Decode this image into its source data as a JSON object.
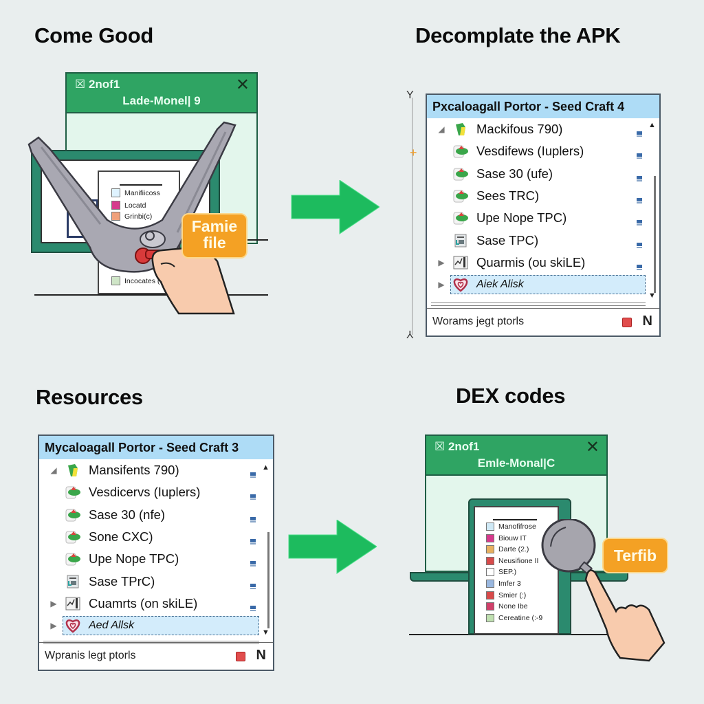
{
  "panels": {
    "top_left": {
      "heading": "Come Good",
      "window": {
        "line1": "☒ 2nof1",
        "line2": "Lade-Monel| 9",
        "close": "✕"
      },
      "paper_items": [
        "Manifiicoss",
        "Locatd",
        "Grinbi(c)",
        "Incocates (3"
      ],
      "callout": {
        "line1": "Famie",
        "line2": "file"
      },
      "tool_icon": "wrench-icon",
      "hand_icon": "hand-pointer-icon"
    },
    "top_right": {
      "heading": "Decomplate the APK",
      "tree": {
        "title": "Pxcaloagall Portor - Seed Craft 4",
        "rows": [
          {
            "toggle": "◢",
            "icon": "android-icon",
            "label": "Mackifous 790)"
          },
          {
            "toggle": "",
            "icon": "package-icon",
            "label": "Vesdifews (Iuplers)"
          },
          {
            "toggle": "",
            "icon": "package-icon",
            "label": "Sase 30 (ufe)"
          },
          {
            "toggle": "",
            "icon": "package-icon",
            "label": "Sees TRC)"
          },
          {
            "toggle": "",
            "icon": "package-icon",
            "label": "Upe Nope TPC)"
          },
          {
            "toggle": "",
            "icon": "file-icon",
            "label": "Sase TPC)"
          },
          {
            "toggle": "▶",
            "icon": "chart-icon",
            "label": "Quarmis (ou skiLE)"
          },
          {
            "toggle": "▶",
            "icon": "heart-icon",
            "label": "Aiek Alisk",
            "selected": true
          }
        ],
        "footer": "Worams jegt ptorls",
        "footer_badge": "N"
      }
    },
    "bottom_left": {
      "heading": "Resources",
      "tree": {
        "title": "Mycaloagall Portor - Seed Craft 3",
        "rows": [
          {
            "toggle": "◢",
            "icon": "android-icon",
            "label": "Mansifents 790)"
          },
          {
            "toggle": "",
            "icon": "package-icon",
            "label": "Vesdicervs (Iuplers)"
          },
          {
            "toggle": "",
            "icon": "package-icon",
            "label": "Sase 30 (nfe)"
          },
          {
            "toggle": "",
            "icon": "package-icon",
            "label": "Sone CXC)"
          },
          {
            "toggle": "",
            "icon": "package-icon",
            "label": "Upe Nope TPC)"
          },
          {
            "toggle": "",
            "icon": "file-icon",
            "label": "Sase TPrC)"
          },
          {
            "toggle": "▶",
            "icon": "chart-icon",
            "label": "Cuamrts (on skiLE)"
          },
          {
            "toggle": "▶",
            "icon": "heart-icon",
            "label": "Aed Allsk",
            "selected": true
          }
        ],
        "footer": "Wpranis legt ptorls",
        "footer_badge": "N"
      }
    },
    "bottom_right": {
      "heading": "DEX codes",
      "window": {
        "line1": "☒ 2nof1",
        "line2": "Emle-Monal|C",
        "close": "✕"
      },
      "paper_items": [
        "Manofifrose",
        "Biouw IT",
        "Darte (2.)",
        "Neusifione II",
        "SEP.)",
        "Imfer 3",
        "Smier (:)",
        "None Ibe",
        "Cereatine (:-9"
      ],
      "callout": {
        "line1": "Terfib"
      },
      "tool_icon": "magnifier-icon",
      "hand_icon": "hand-pointer-icon"
    }
  },
  "colors": {
    "arrow": "#1dbb5e",
    "window_bar": "#2fa463",
    "tree_title": "#aedcf6",
    "callout": "#f4a124"
  }
}
